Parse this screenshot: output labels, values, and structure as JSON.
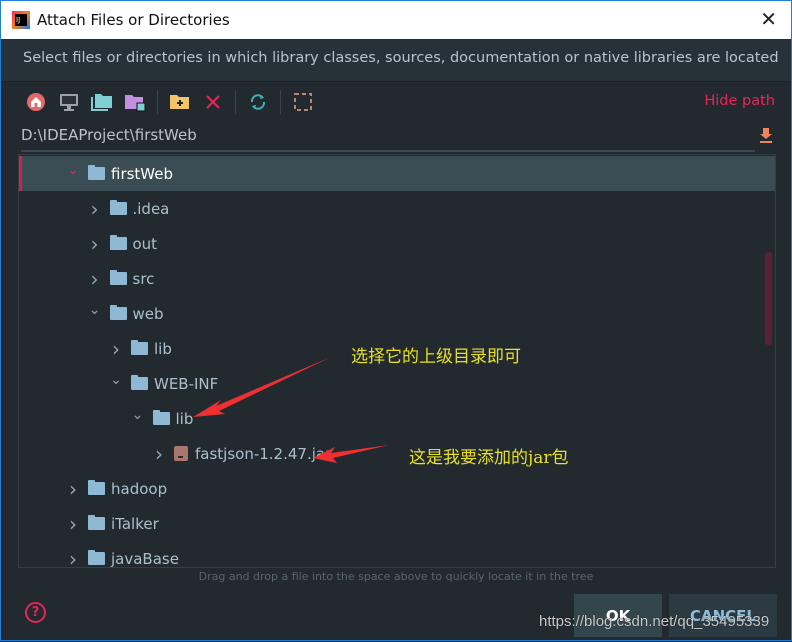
{
  "window": {
    "title": "Attach Files or Directories",
    "close_label": "✕"
  },
  "description": "Select files or directories in which library classes, sources, documentation or native libraries are located",
  "toolbar": {
    "icons": [
      "home-icon",
      "desktop-icon",
      "project-folder-icon",
      "module-folder-icon",
      "new-folder-icon",
      "delete-icon",
      "refresh-icon",
      "show-hidden-icon"
    ],
    "hide_path": "Hide path"
  },
  "path": "D:\\IDEAProject\\firstWeb",
  "tree": [
    {
      "label": "firstWeb",
      "level": 0,
      "expanded": true,
      "selected": true,
      "type": "folder"
    },
    {
      "label": ".idea",
      "level": 1,
      "expanded": false,
      "type": "folder"
    },
    {
      "label": "out",
      "level": 1,
      "expanded": false,
      "type": "folder"
    },
    {
      "label": "src",
      "level": 1,
      "expanded": false,
      "type": "folder"
    },
    {
      "label": "web",
      "level": 1,
      "expanded": true,
      "type": "folder"
    },
    {
      "label": "lib",
      "level": 2,
      "expanded": false,
      "type": "folder"
    },
    {
      "label": "WEB-INF",
      "level": 2,
      "expanded": true,
      "type": "folder"
    },
    {
      "label": "lib",
      "level": 3,
      "expanded": true,
      "type": "folder"
    },
    {
      "label": "fastjson-1.2.47.jar",
      "level": 4,
      "expanded": false,
      "type": "jar"
    },
    {
      "label": "hadoop",
      "level": 0,
      "expanded": false,
      "type": "folder"
    },
    {
      "label": "iTalker",
      "level": 0,
      "expanded": false,
      "type": "folder"
    },
    {
      "label": "javaBase",
      "level": 0,
      "expanded": false,
      "type": "folder"
    }
  ],
  "hint": "Drag and drop a file into the space above to quickly locate it in the tree",
  "buttons": {
    "ok": "OK",
    "cancel": "CANCEL",
    "help": "?"
  },
  "annotations": {
    "select_parent": "选择它的上级目录即可",
    "jar_to_add": "这是我要添加的jar包"
  },
  "watermark": "https://blog.csdn.net/qq_35495339",
  "colors": {
    "accent": "#e8245a",
    "background": "#222a30",
    "selection": "#3a4d54",
    "annotation": "#e8e020"
  }
}
